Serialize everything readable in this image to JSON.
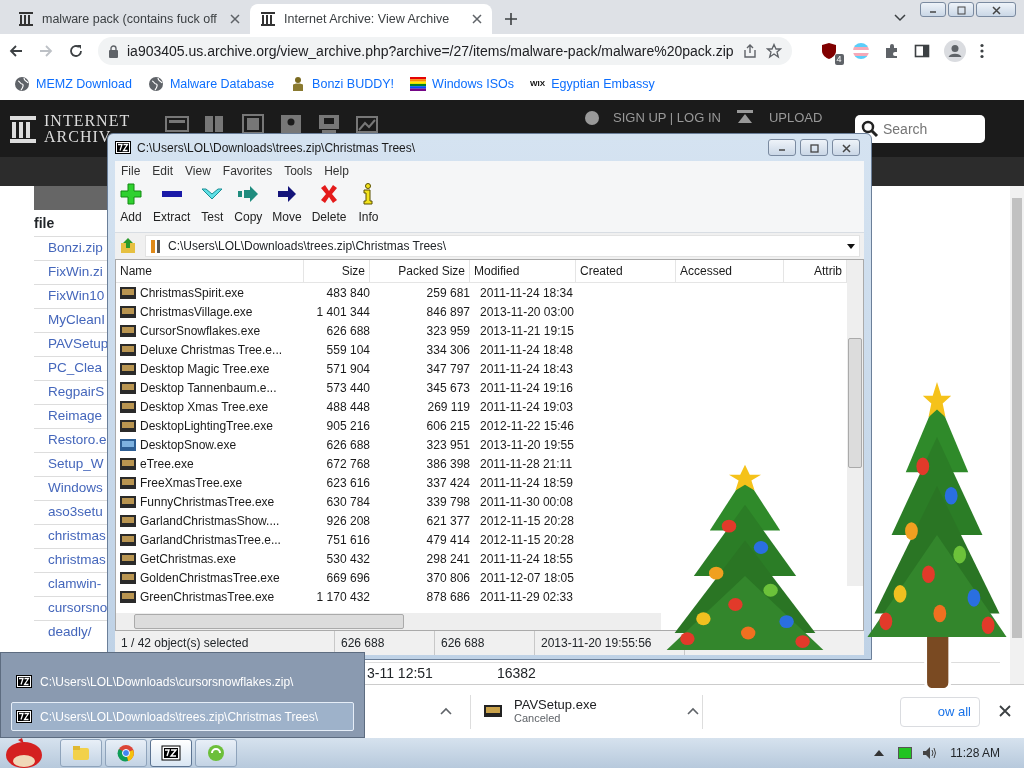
{
  "browser": {
    "tabs": [
      {
        "title": "malware pack (contains fuck off",
        "selected": false
      },
      {
        "title": "Internet Archive: View Archive",
        "selected": true
      }
    ],
    "address": "ia903405.us.archive.org/view_archive.php?archive=/27/items/malware-pack/malware%20pack.zip",
    "extension_badge": "4",
    "bookmarks": [
      {
        "label": "MEMZ Download",
        "kind": "globe"
      },
      {
        "label": "Malware Database",
        "kind": "globe"
      },
      {
        "label": "Bonzi BUDDY!",
        "kind": "figure"
      },
      {
        "label": "Windows ISOs",
        "kind": "flag"
      },
      {
        "label": "Egyptian Embassy",
        "kind": "wordmark",
        "mark": "WIX"
      }
    ]
  },
  "archive_page": {
    "logo": [
      "INTERNET",
      "ARCHIV"
    ],
    "sign_in": "SIGN UP | LOG IN",
    "upload": "UPLOAD",
    "search_placeholder": "Search",
    "file_heading": "file",
    "files": [
      "Bonzi.zip",
      "FixWin.zi",
      "FixWin10",
      "MyCleanI",
      "PAVSetup",
      "PC_Clea",
      "RegpairS",
      "Reimage",
      "Restoro.e",
      "Setup_W",
      "Windows",
      "aso3setu",
      "christmas",
      "christmas",
      "clamwin-",
      "cursorsno",
      "deadly/"
    ],
    "cut_row": {
      "column_1": "3-11 12:51",
      "column_2": "16382"
    }
  },
  "downloads": [
    {
      "name": "PAVSetup.exe",
      "status": "Canceled"
    }
  ],
  "show_all": "ow all",
  "sevenzip": {
    "title": "C:\\Users\\LOL\\Downloads\\trees.zip\\Christmas Trees\\",
    "menu": [
      "File",
      "Edit",
      "View",
      "Favorites",
      "Tools",
      "Help"
    ],
    "tools": [
      {
        "label": "Add",
        "kind": "add"
      },
      {
        "label": "Extract",
        "kind": "extract"
      },
      {
        "label": "Test",
        "kind": "test"
      },
      {
        "label": "Copy",
        "kind": "copy"
      },
      {
        "label": "Move",
        "kind": "move"
      },
      {
        "label": "Delete",
        "kind": "delete"
      },
      {
        "label": "Info",
        "kind": "info"
      }
    ],
    "path": "C:\\Users\\LOL\\Downloads\\trees.zip\\Christmas Trees\\",
    "columns": [
      "Name",
      "Size",
      "Packed Size",
      "Modified",
      "Created",
      "Accessed",
      "Attrib"
    ],
    "rows": [
      {
        "name": "ChristmasSpirit.exe",
        "size": "483 840",
        "packed": "259 681",
        "modified": "2011-11-24 18:34",
        "kind": "dark"
      },
      {
        "name": "ChristmasVillage.exe",
        "size": "1 401 344",
        "packed": "846 897",
        "modified": "2013-11-20 03:00",
        "kind": "dark"
      },
      {
        "name": "CursorSnowflakes.exe",
        "size": "626 688",
        "packed": "323 959",
        "modified": "2013-11-21 19:15",
        "kind": "dark"
      },
      {
        "name": "Deluxe Christmas Tree.e...",
        "size": "559 104",
        "packed": "334 306",
        "modified": "2011-11-24 18:48",
        "kind": "dark"
      },
      {
        "name": "Desktop Magic Tree.exe",
        "size": "571 904",
        "packed": "347 797",
        "modified": "2011-11-24 18:43",
        "kind": "dark"
      },
      {
        "name": "Desktop Tannenbaum.e...",
        "size": "573 440",
        "packed": "345 673",
        "modified": "2011-11-24 19:16",
        "kind": "dark"
      },
      {
        "name": "Desktop Xmas Tree.exe",
        "size": "488 448",
        "packed": "269 119",
        "modified": "2011-11-24 19:03",
        "kind": "dark"
      },
      {
        "name": "DesktopLightingTree.exe",
        "size": "905 216",
        "packed": "606 215",
        "modified": "2012-11-22 15:46",
        "kind": "dark"
      },
      {
        "name": "DesktopSnow.exe",
        "size": "626 688",
        "packed": "323 951",
        "modified": "2013-11-20 19:55",
        "kind": "blue"
      },
      {
        "name": "eTree.exe",
        "size": "672 768",
        "packed": "386 398",
        "modified": "2011-11-28 21:11",
        "kind": "dark"
      },
      {
        "name": "FreeXmasTree.exe",
        "size": "623 616",
        "packed": "337 424",
        "modified": "2011-11-24 18:59",
        "kind": "dark"
      },
      {
        "name": "FunnyChristmasTree.exe",
        "size": "630 784",
        "packed": "339 798",
        "modified": "2011-11-30 00:08",
        "kind": "dark"
      },
      {
        "name": "GarlandChristmasShow....",
        "size": "926 208",
        "packed": "621 377",
        "modified": "2012-11-15 20:28",
        "kind": "dark"
      },
      {
        "name": "GarlandChristmasTree.e...",
        "size": "751 616",
        "packed": "479 414",
        "modified": "2012-11-15 20:28",
        "kind": "dark"
      },
      {
        "name": "GetChristmas.exe",
        "size": "530 432",
        "packed": "298 241",
        "modified": "2011-11-24 18:55",
        "kind": "dark"
      },
      {
        "name": "GoldenChristmasTree.exe",
        "size": "669 696",
        "packed": "370 806",
        "modified": "2011-12-07 18:05",
        "kind": "dark"
      },
      {
        "name": "GreenChristmasTree.exe",
        "size": "1 170 432",
        "packed": "878 686",
        "modified": "2011-11-29 02:33",
        "kind": "dark"
      }
    ],
    "status": [
      "1 / 42 object(s) selected",
      "626 688",
      "626 688",
      "2013-11-20 19:55:56"
    ]
  },
  "jump_list": [
    {
      "path": "C:\\Users\\LOL\\Downloads\\cursorsnowflakes.zip\\",
      "selected": false
    },
    {
      "path": "C:\\Users\\LOL\\Downloads\\trees.zip\\Christmas Trees\\",
      "selected": true
    }
  ],
  "taskbar": {
    "buttons": [
      {
        "kind": "folder",
        "active": false
      },
      {
        "kind": "browser",
        "active": false
      },
      {
        "kind": "sevenzip",
        "active": true
      },
      {
        "kind": "green",
        "active": false
      }
    ],
    "clock": "11:28 AM"
  }
}
